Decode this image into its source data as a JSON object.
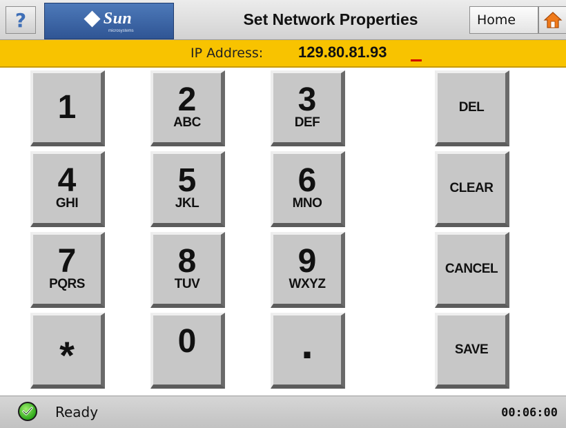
{
  "header": {
    "help_label": "?",
    "logo_text": "Sun",
    "logo_sub": "microsystems",
    "title": "Set Network Properties",
    "home_label": "Home",
    "home_icon": "house-icon"
  },
  "ip": {
    "label": "IP Address:",
    "value": "129.80.81.93"
  },
  "keypad": {
    "keys": [
      {
        "num": "1",
        "letters": ""
      },
      {
        "num": "2",
        "letters": "ABC"
      },
      {
        "num": "3",
        "letters": "DEF"
      },
      {
        "num": "4",
        "letters": "GHI"
      },
      {
        "num": "5",
        "letters": "JKL"
      },
      {
        "num": "6",
        "letters": "MNO"
      },
      {
        "num": "7",
        "letters": "PQRS"
      },
      {
        "num": "8",
        "letters": "TUV"
      },
      {
        "num": "9",
        "letters": "WXYZ"
      },
      {
        "num": "*",
        "letters": ""
      },
      {
        "num": "0",
        "letters": ""
      },
      {
        "num": ".",
        "letters": ""
      }
    ]
  },
  "actions": {
    "del": "DEL",
    "clear": "CLEAR",
    "cancel": "CANCEL",
    "save": "SAVE"
  },
  "status": {
    "text": "Ready",
    "time": "00:06:00",
    "icon": "check-circle-icon"
  },
  "colors": {
    "ip_bar": "#f8c300",
    "logo_blue": "#3a63a6",
    "home_icon": "#f07a1a",
    "cursor": "#d20000",
    "status_ok": "#2ea81b"
  }
}
